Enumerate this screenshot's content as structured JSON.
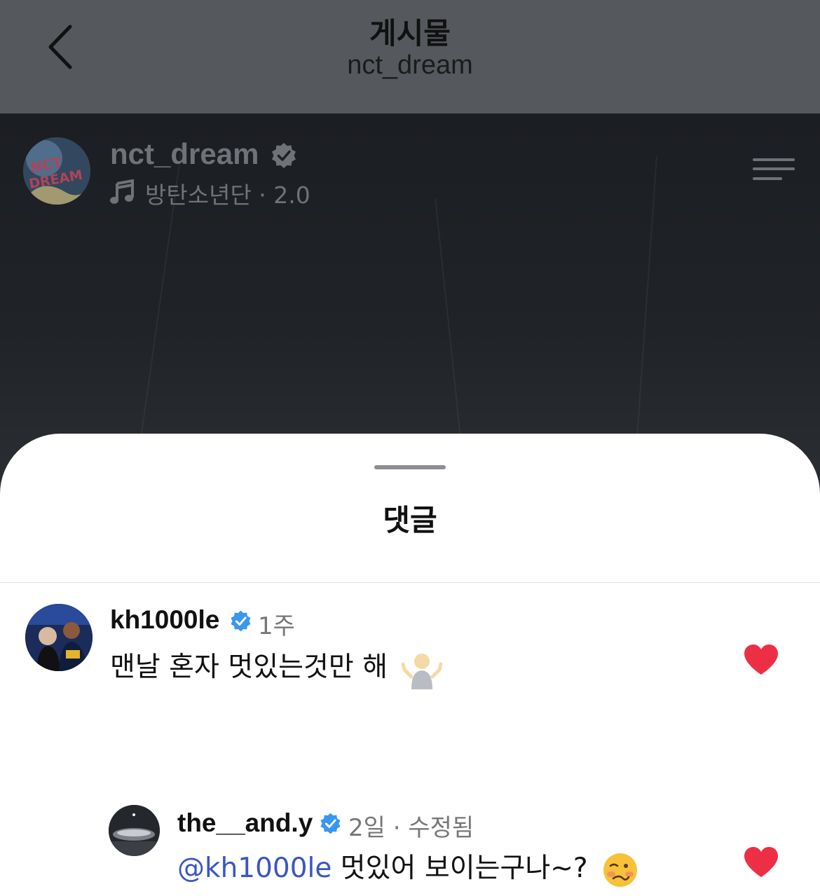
{
  "nav": {
    "title": "게시물",
    "subtitle": "nct_dream"
  },
  "post": {
    "username": "nct_dream",
    "music": "방탄소년단 · 2.0",
    "avatar_text": "NCT DREAM"
  },
  "comments_sheet": {
    "title": "댓글",
    "comments": [
      {
        "username": "kh1000le",
        "time": "1주",
        "text": "맨날 혼자 멋있는것만 해",
        "emoji": "person-shrugging-emoji",
        "liked": true
      },
      {
        "username": "the__and.y",
        "time": "2일 · 수정됨",
        "mention": "@kh1000le",
        "text": " 멋있어 보이는구나~?",
        "emoji": "woozy-face-emoji",
        "liked": true
      }
    ]
  },
  "colors": {
    "nav_bg": "#55595e",
    "media_bg": "#1d2024",
    "verified": "#3897f0",
    "heart": "#ed2f45",
    "mention": "#3a56c4"
  }
}
